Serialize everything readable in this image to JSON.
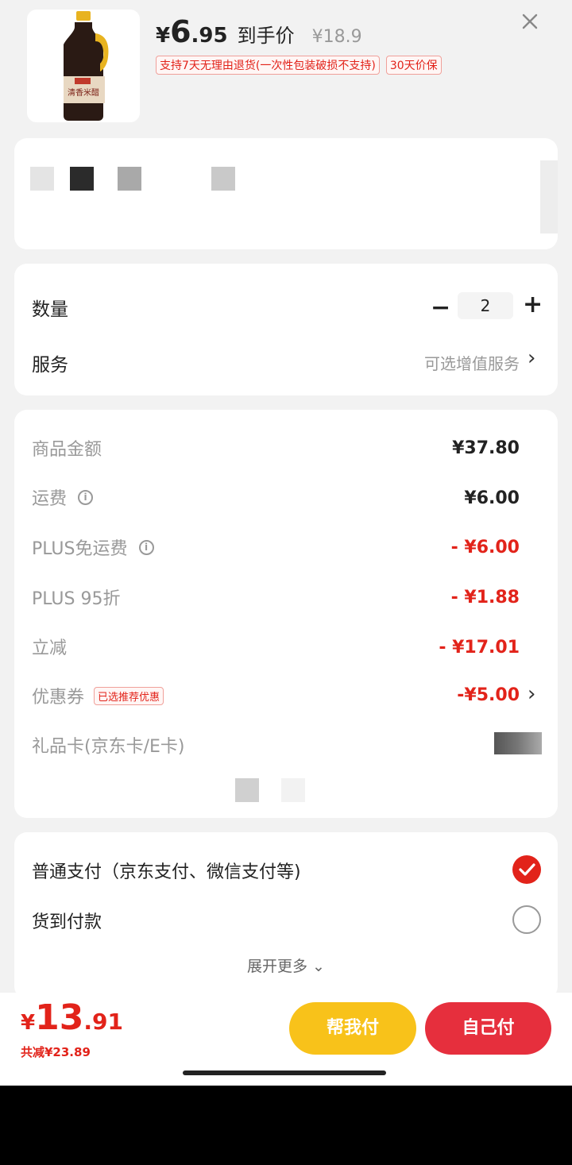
{
  "product": {
    "image_label": "清香米醋",
    "price_yen": "¥",
    "price_int": "6",
    "price_dec": ".95",
    "price_tag": "到手价",
    "original_price": "¥18.9",
    "tags": [
      "支持7天无理由退货(一次性包装破损不支持)",
      "30天价保"
    ]
  },
  "header": {
    "close_icon": "close-icon"
  },
  "quantity": {
    "label": "数量",
    "value": "2",
    "minus": "−",
    "plus": "+"
  },
  "service": {
    "label": "服务",
    "hint": "可选增值服务",
    "chevron": "›"
  },
  "price_detail": {
    "goods_amount": {
      "label": "商品金额",
      "value": "¥37.80"
    },
    "shipping": {
      "label": "运费",
      "value": "¥6.00"
    },
    "plus_free_shipping": {
      "label": "PLUS免运费",
      "value": "- ¥6.00"
    },
    "plus_discount": {
      "label": "PLUS 95折",
      "value": "- ¥1.88"
    },
    "instant_discount": {
      "label": "立减",
      "value": "- ¥17.01"
    },
    "coupon": {
      "label": "优惠券",
      "badge": "已选推荐优惠",
      "value": "-¥5.00",
      "chevron": "›"
    },
    "gift_card": {
      "label": "礼品卡(京东卡/E卡)"
    }
  },
  "payment": {
    "options": [
      {
        "label": "普通支付（京东支付、微信支付等)",
        "selected": true
      },
      {
        "label": "货到付款",
        "selected": false
      }
    ],
    "expand_label": "展开更多 ⌄"
  },
  "footer": {
    "total_yen": "¥",
    "total_int": "13",
    "total_dec": ".91",
    "saved": "共减¥23.89",
    "help_pay": "帮我付",
    "self_pay": "自己付"
  },
  "colors": {
    "accent_red": "#e2231a",
    "help_yellow": "#f8c21a",
    "self_red": "#e62f3d"
  }
}
